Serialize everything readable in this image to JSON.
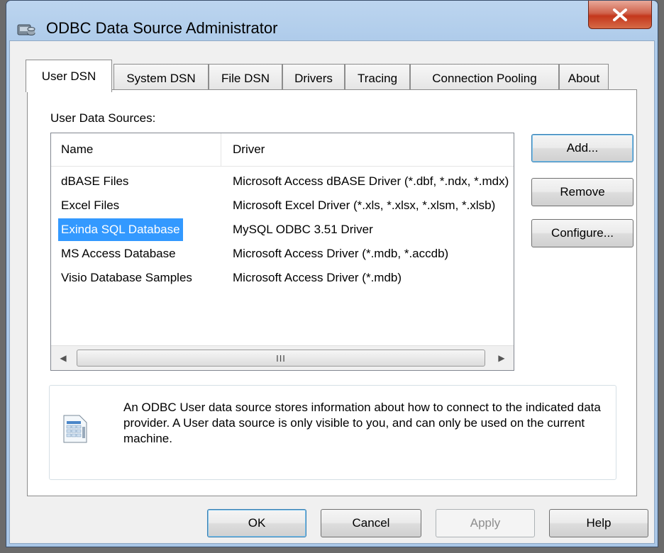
{
  "window": {
    "title": "ODBC Data Source Administrator",
    "close_label": "X",
    "accent_color": "#c4371c"
  },
  "tabs": [
    {
      "label": "User DSN",
      "active": true
    },
    {
      "label": "System DSN",
      "active": false
    },
    {
      "label": "File DSN",
      "active": false
    },
    {
      "label": "Drivers",
      "active": false
    },
    {
      "label": "Tracing",
      "active": false
    },
    {
      "label": "Connection Pooling",
      "active": false
    },
    {
      "label": "About",
      "active": false
    }
  ],
  "panel": {
    "sources_label": "User Data Sources:",
    "columns": [
      "Name",
      "Driver"
    ],
    "rows": [
      {
        "name": "dBASE Files",
        "driver": "Microsoft Access dBASE Driver (*.dbf, *.ndx, *.mdx)",
        "selected": false
      },
      {
        "name": "Excel Files",
        "driver": "Microsoft Excel Driver (*.xls, *.xlsx, *.xlsm, *.xlsb)",
        "selected": false
      },
      {
        "name": "Exinda SQL Database",
        "driver": "MySQL ODBC 3.51 Driver",
        "selected": true
      },
      {
        "name": "MS Access Database",
        "driver": "Microsoft Access Driver (*.mdb, *.accdb)",
        "selected": false
      },
      {
        "name": "Visio Database Samples",
        "driver": "Microsoft Access Driver (*.mdb)",
        "selected": false
      }
    ],
    "scroll_grip": "III",
    "add_label": "Add...",
    "remove_label": "Remove",
    "configure_label": "Configure...",
    "info_text": "An ODBC User data source stores information about how to connect to the indicated data provider.   A User data source is only visible to you, and can only be used on the current machine.",
    "selection_color": "#3399ff"
  },
  "footer": {
    "ok_label": "OK",
    "cancel_label": "Cancel",
    "apply_label": "Apply",
    "help_label": "Help"
  }
}
